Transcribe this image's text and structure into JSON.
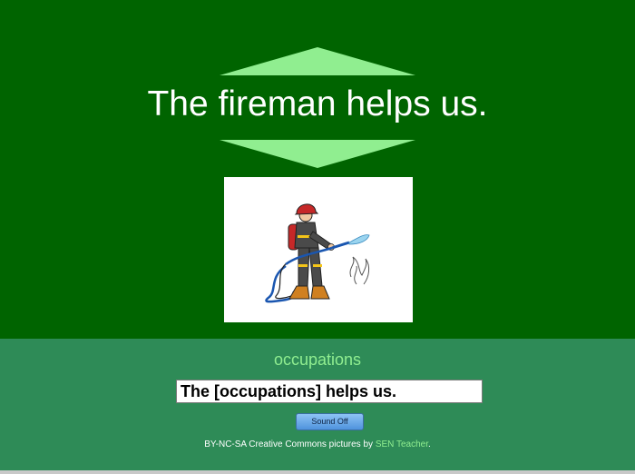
{
  "main": {
    "sentence": "The fireman helps us.",
    "picture_icon": "fireman-with-hose"
  },
  "controls": {
    "category": "occupations",
    "template_value": "The [occupations] helps us.",
    "sound_button_label": "Sound Off"
  },
  "footer": {
    "credit_text": "BY-NC-SA Creative Commons pictures by ",
    "credit_link": "SEN Teacher",
    "credit_end": "."
  },
  "colors": {
    "top_background": "#006400",
    "bottom_background": "#2e8b57",
    "accent": "#90ee90"
  }
}
